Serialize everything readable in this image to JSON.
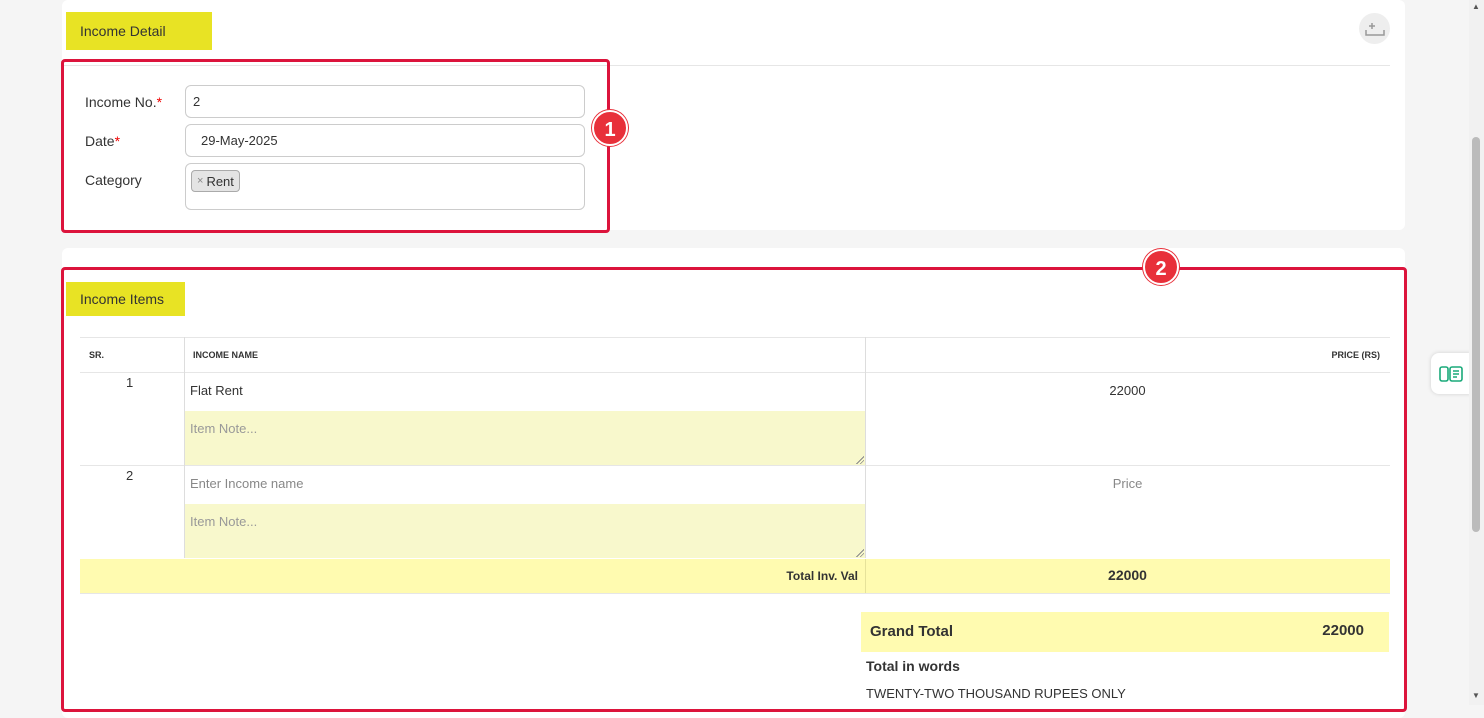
{
  "income_detail": {
    "title": "Income Detail",
    "income_no_label": "Income No.",
    "income_no_value": "2",
    "date_label": "Date",
    "date_value": "29-May-2025",
    "category_label": "Category",
    "category_tag": "Rent",
    "required_mark": "*"
  },
  "annotations": {
    "badge1": "1",
    "badge2": "2"
  },
  "income_items": {
    "title": "Income Items",
    "headers": {
      "sr": "SR.",
      "name": "INCOME NAME",
      "price": "PRICE (RS)"
    },
    "rows": [
      {
        "sr": "1",
        "name": "Flat Rent",
        "price": "22000",
        "note_placeholder": "Item Note..."
      },
      {
        "sr": "2",
        "name_placeholder": "Enter Income name",
        "price_placeholder": "Price",
        "note_placeholder": "Item Note..."
      }
    ],
    "total_label": "Total Inv. Val",
    "total_value": "22000"
  },
  "summary": {
    "grand_total_label": "Grand Total",
    "grand_total_value": "22000",
    "words_label": "Total in words",
    "words_value": "TWENTY-TWO THOUSAND RUPEES ONLY"
  },
  "colors": {
    "section_tag": "#e8e324",
    "highlight_row": "#fffbb0",
    "note_bg": "#f8f8cc",
    "annotation_red": "#dc143c"
  },
  "icons": {
    "add_row": "add-row-icon",
    "side_widget": "notes-widget-icon"
  }
}
